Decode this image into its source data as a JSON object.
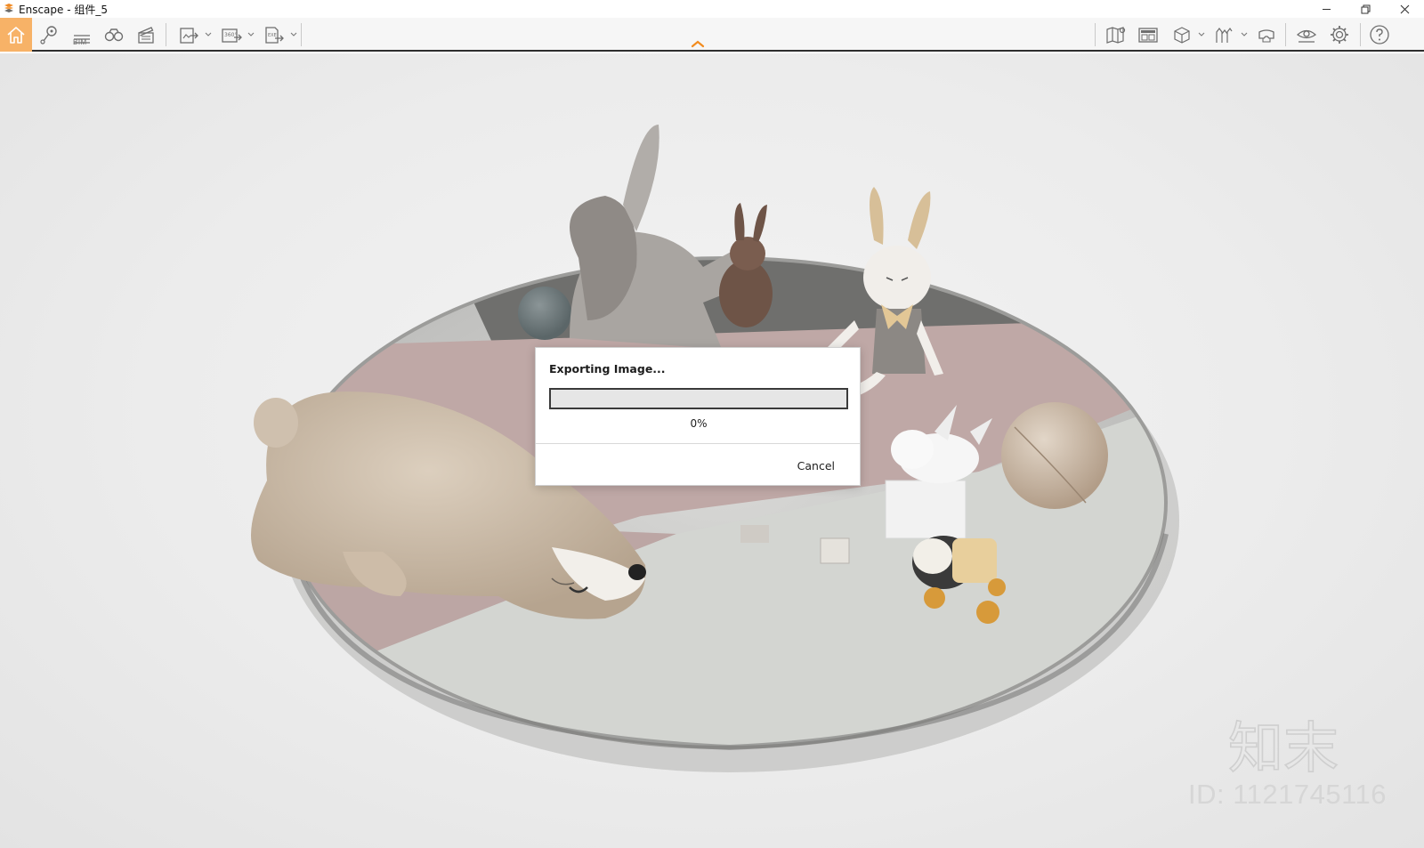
{
  "window": {
    "title": "Enscape - 组件_5",
    "controls": [
      "minimize",
      "restore",
      "close"
    ]
  },
  "toolbar": {
    "bim_label": "BIM",
    "left_icons": [
      "home-icon",
      "location-pin-icon",
      "bim-icon",
      "binoculars-icon",
      "video-editor-icon"
    ],
    "export_icons": [
      "screenshot-export-icon",
      "panorama-360-export-icon",
      "exe-export-icon"
    ],
    "right_icons": [
      "map-icon",
      "window-icon",
      "cube-icon",
      "vegetation-icon",
      "vr-headset-icon",
      "eye-icon",
      "settings-icon",
      "help-icon"
    ],
    "accent_color": "#f7b267",
    "collapse_color": "#f28c1f"
  },
  "dialog": {
    "title": "Exporting Image...",
    "progress_value": 0,
    "progress_text": "0%",
    "cancel_label": "Cancel"
  },
  "watermark": {
    "brand": "知末",
    "id_text": "ID: 1121745116"
  }
}
